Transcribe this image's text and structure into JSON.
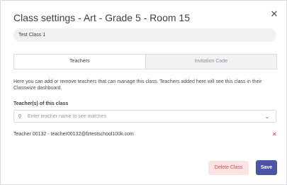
{
  "dialog": {
    "title": "Class settings - Art - Grade 5 - Room 15",
    "close_icon": "close-icon"
  },
  "class_name_field": {
    "value": "Test Class 1"
  },
  "tabs": [
    {
      "label": "Teachers",
      "active": true
    },
    {
      "label": "Invitation Code",
      "active": false
    }
  ],
  "teachers_panel": {
    "description": "Here you can add or remove teachers that can manage this class. Teachers added here will see this class in their Classwize dashboard.",
    "section_label": "Teacher(s) of this class",
    "search": {
      "placeholder": "Enter teacher name to see matches",
      "icon": "search-icon",
      "dropdown_icon": "chevron-down-icon"
    },
    "teachers": [
      {
        "label": "Teacher 00132 - teacher00132@fztestschool100k.com",
        "remove_icon": "remove-icon"
      }
    ]
  },
  "actions": {
    "delete_label": "Delete Class",
    "save_label": "Save"
  },
  "colors": {
    "accent": "#4c55a5",
    "danger": "#e0413c",
    "danger_bg": "#fbe3e4"
  }
}
